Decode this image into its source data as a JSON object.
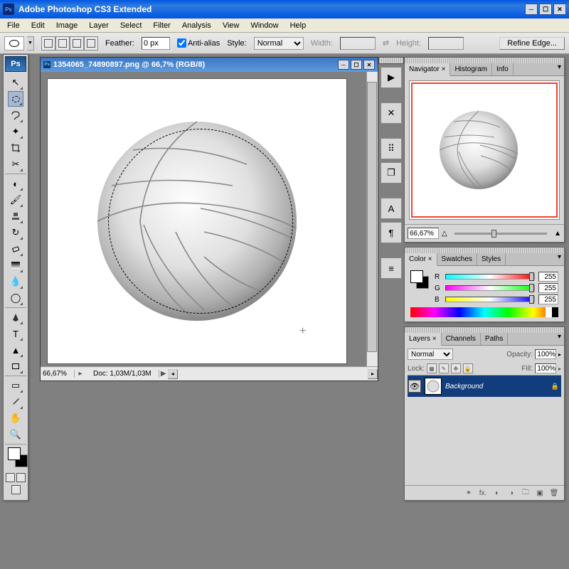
{
  "app": {
    "title": "Adobe Photoshop CS3 Extended",
    "icon_text": "Ps"
  },
  "menu": [
    "File",
    "Edit",
    "Image",
    "Layer",
    "Select",
    "Filter",
    "Analysis",
    "View",
    "Window",
    "Help"
  ],
  "options": {
    "feather_label": "Feather:",
    "feather_value": "0 px",
    "antialias_label": "Anti-alias",
    "antialias_checked": true,
    "style_label": "Style:",
    "style_value": "Normal",
    "width_label": "Width:",
    "height_label": "Height:",
    "refine_label": "Refine Edge..."
  },
  "document": {
    "title": "1354065_74890897.png @ 66,7% (RGB/8)",
    "zoom": "66,67%",
    "doc_stat": "Doc: 1,03M/1,03M"
  },
  "navigator": {
    "tabs": [
      "Navigator",
      "Histogram",
      "Info"
    ],
    "zoom": "66,67%"
  },
  "color": {
    "tabs": [
      "Color",
      "Swatches",
      "Styles"
    ],
    "r": 255,
    "g": 255,
    "b": 255,
    "r_label": "R",
    "g_label": "G",
    "b_label": "B"
  },
  "layers": {
    "tabs": [
      "Layers",
      "Channels",
      "Paths"
    ],
    "blend_mode": "Normal",
    "opacity_label": "Opacity:",
    "opacity": "100%",
    "lock_label": "Lock:",
    "fill_label": "Fill:",
    "fill": "100%",
    "layer_name": "Background"
  },
  "toolbox": {
    "header": "Ps"
  }
}
